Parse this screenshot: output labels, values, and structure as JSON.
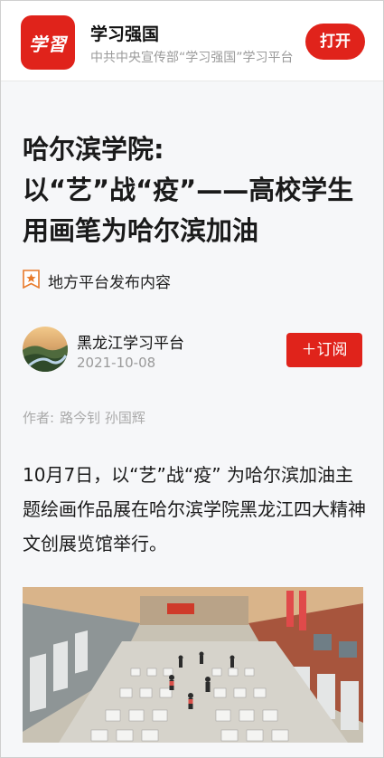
{
  "banner": {
    "logo_text": "学習",
    "app_name": "学习强国",
    "app_description": "中共中央宣传部“学习强国”学习平台",
    "open_label": "打开"
  },
  "article": {
    "title": "哈尔滨学院:\n以“艺”战“疫”——高校学生用画笔为哈尔滨加油",
    "source_label": "地方平台发布内容",
    "publisher": {
      "name": "黑龙江学习平台",
      "date": "2021-10-08",
      "subscribe_label": "＋订阅"
    },
    "author_label": "作者:",
    "author_names": "路今钊 孙国辉",
    "body": "10月7日，以“艺”战“疫” 为哈尔滨加油主题绘画作品展在哈尔滨学院黑龙江四大精神文创展览馆举行。"
  },
  "colors": {
    "brand_red": "#e0231b",
    "muted_text": "#9a9a9a"
  },
  "icons": {
    "source": "platform-badge-icon"
  }
}
